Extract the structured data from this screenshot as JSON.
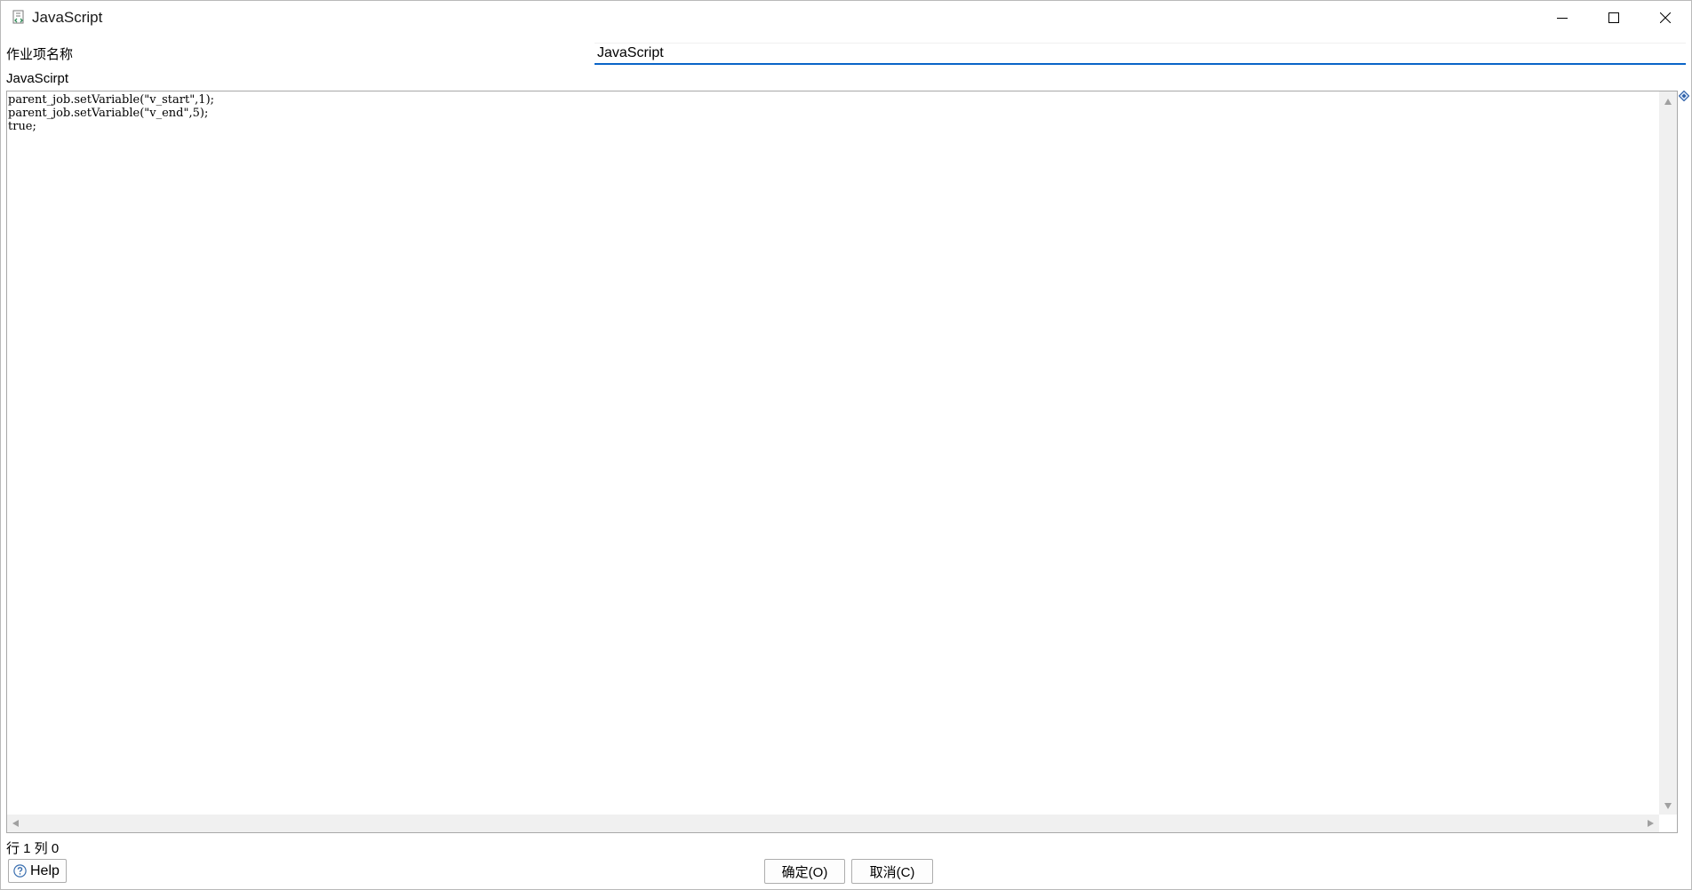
{
  "window": {
    "title": "JavaScript"
  },
  "controls": {
    "minimize_icon": "minimize-icon",
    "maximize_icon": "maximize-icon",
    "close_icon": "close-icon"
  },
  "form": {
    "name_label": "作业项名称",
    "name_value": "JavaScript",
    "script_label": "JavaScirpt"
  },
  "editor": {
    "lines": [
      "parent_job.setVariable(\"v_start\",1);",
      "parent_job.setVariable(\"v_end\",5);",
      "true;"
    ]
  },
  "status": {
    "position": "行 1 列 0"
  },
  "footer": {
    "help_label": "Help",
    "ok_label": "确定(O)",
    "cancel_label": "取消(C)"
  },
  "colors": {
    "accent": "#0a64c8",
    "scrollbar": "#f0f0f0",
    "border": "#a8a8a8"
  }
}
